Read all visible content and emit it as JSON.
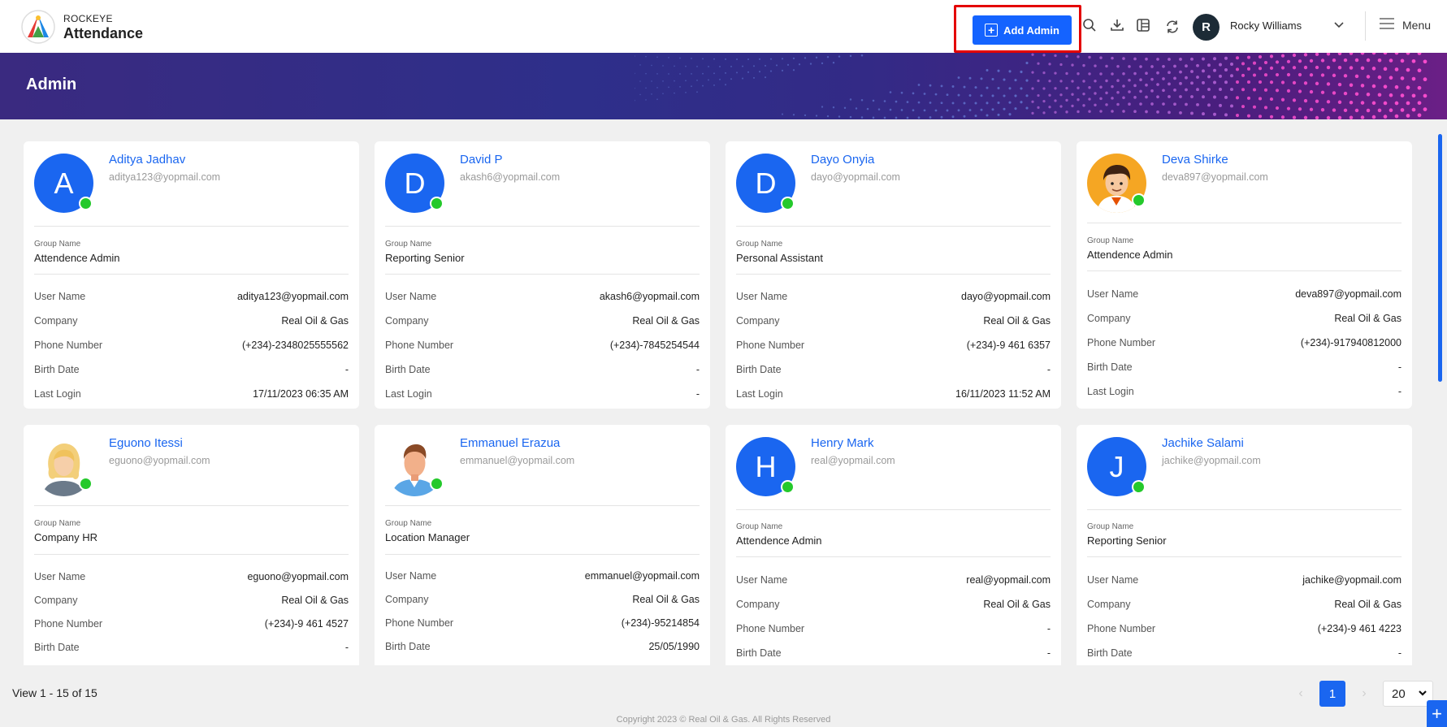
{
  "brand": {
    "small": "ROCKEYE",
    "big": "Attendance"
  },
  "header": {
    "add_admin_label": "Add Admin",
    "user_initial": "R",
    "user_name": "Rocky Williams",
    "menu_label": "Menu"
  },
  "banner": {
    "title": "Admin"
  },
  "labels": {
    "group_name": "Group Name",
    "user_name": "User Name",
    "company": "Company",
    "phone": "Phone Number",
    "birth": "Birth Date",
    "last_login": "Last Login"
  },
  "admins": [
    {
      "initial": "A",
      "name": "Aditya Jadhav",
      "email": "aditya123@yopmail.com",
      "group": "Attendence Admin",
      "user_name": "aditya123@yopmail.com",
      "company": "Real Oil & Gas",
      "phone": "(+234)-2348025555562",
      "birth": "-",
      "last_login": "17/11/2023 06:35 AM"
    },
    {
      "initial": "D",
      "name": "David P",
      "email": "akash6@yopmail.com",
      "group": "Reporting Senior",
      "user_name": "akash6@yopmail.com",
      "company": "Real Oil & Gas",
      "phone": "(+234)-7845254544",
      "birth": "-",
      "last_login": "-"
    },
    {
      "initial": "D",
      "name": "Dayo Onyia",
      "email": "dayo@yopmail.com",
      "group": "Personal Assistant",
      "user_name": "dayo@yopmail.com",
      "company": "Real Oil & Gas",
      "phone": "(+234)-9 461 6357",
      "birth": "-",
      "last_login": "16/11/2023 11:52 AM"
    },
    {
      "initial": "",
      "name": "Deva Shirke",
      "email": "deva897@yopmail.com",
      "group": "Attendence Admin",
      "user_name": "deva897@yopmail.com",
      "company": "Real Oil & Gas",
      "phone": "(+234)-917940812000",
      "birth": "-",
      "last_login": "-"
    },
    {
      "initial": "",
      "name": "Eguono Itessi",
      "email": "eguono@yopmail.com",
      "group": "Company HR",
      "user_name": "eguono@yopmail.com",
      "company": "Real Oil & Gas",
      "phone": "(+234)-9 461 4527",
      "birth": "-",
      "last_login": ""
    },
    {
      "initial": "",
      "name": "Emmanuel Erazua",
      "email": "emmanuel@yopmail.com",
      "group": "Location Manager",
      "user_name": "emmanuel@yopmail.com",
      "company": "Real Oil & Gas",
      "phone": "(+234)-95214854",
      "birth": "25/05/1990",
      "last_login": ""
    },
    {
      "initial": "H",
      "name": "Henry Mark",
      "email": "real@yopmail.com",
      "group": "Attendence Admin",
      "user_name": "real@yopmail.com",
      "company": "Real Oil & Gas",
      "phone": "-",
      "birth": "-",
      "last_login": ""
    },
    {
      "initial": "J",
      "name": "Jachike Salami",
      "email": "jachike@yopmail.com",
      "group": "Reporting Senior",
      "user_name": "jachike@yopmail.com",
      "company": "Real Oil & Gas",
      "phone": "(+234)-9 461 4223",
      "birth": "-",
      "last_login": ""
    }
  ],
  "footer": {
    "view_count": "View 1 - 15 of 15",
    "current_page": "1",
    "page_size": "20",
    "copyright": "Copyright 2023 © Real Oil & Gas. All Rights Reserved"
  },
  "colors": {
    "primary": "#1a66f0",
    "online": "#24c92b",
    "highlight": "#e40000"
  }
}
